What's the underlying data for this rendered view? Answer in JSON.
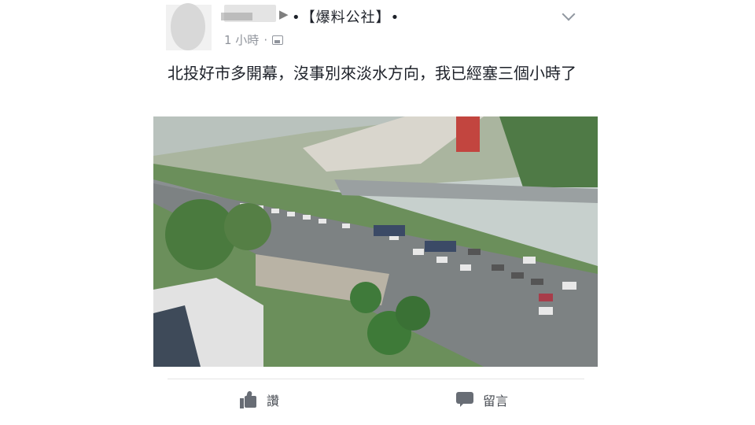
{
  "post": {
    "group_arrow": "▶",
    "group_name": "•【爆料公社】•",
    "timestamp": "1 小時",
    "separator": "·",
    "privacy_icon": "album-icon",
    "text": "北投好市多開幕，沒事別來淡水方向，我已經塞三個小時了",
    "menu_icon": "chevron-down-icon"
  },
  "actions": {
    "like_label": "讚",
    "like_icon": "thumbs-up-icon",
    "comment_label": "留言",
    "comment_icon": "comment-bubble-icon"
  },
  "colors": {
    "text": "#1d2129",
    "meta": "#90949c",
    "action": "#4b4f56"
  }
}
